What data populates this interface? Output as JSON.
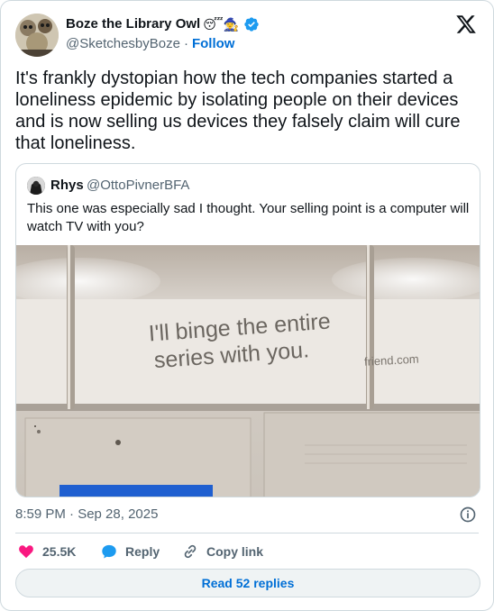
{
  "author": {
    "display_name": "Boze the Library Owl",
    "emoji": "😴🧙‍♀️",
    "handle": "@SketchesbyBoze",
    "separator": "·",
    "follow_label": "Follow"
  },
  "tweet": {
    "text": "It's frankly dystopian how the tech companies started a loneliness epidemic by isolating people on their devices and is now selling us devices they falsely claim will cure that loneliness."
  },
  "quoted_tweet": {
    "name": "Rhys",
    "handle": "@OttoPivnerBFA",
    "text": "This one was especially sad I thought. Your selling point is a computer will watch TV with you?",
    "photo": {
      "ad_line1": "I'll binge the entire",
      "ad_line2": "series with you.",
      "ad_url": "friend.com"
    }
  },
  "meta": {
    "timestamp": "8:59 PM · Sep 28, 2025"
  },
  "actions": {
    "like_count": "25.5K",
    "reply_label": "Reply",
    "copy_label": "Copy link"
  },
  "footer": {
    "read_replies_label": "Read 52 replies"
  },
  "colors": {
    "link_blue": "#006fd6",
    "verified_blue": "#1d9bf0",
    "like_pink": "#f91880",
    "secondary_text": "#536471",
    "border": "#cfd9de"
  }
}
